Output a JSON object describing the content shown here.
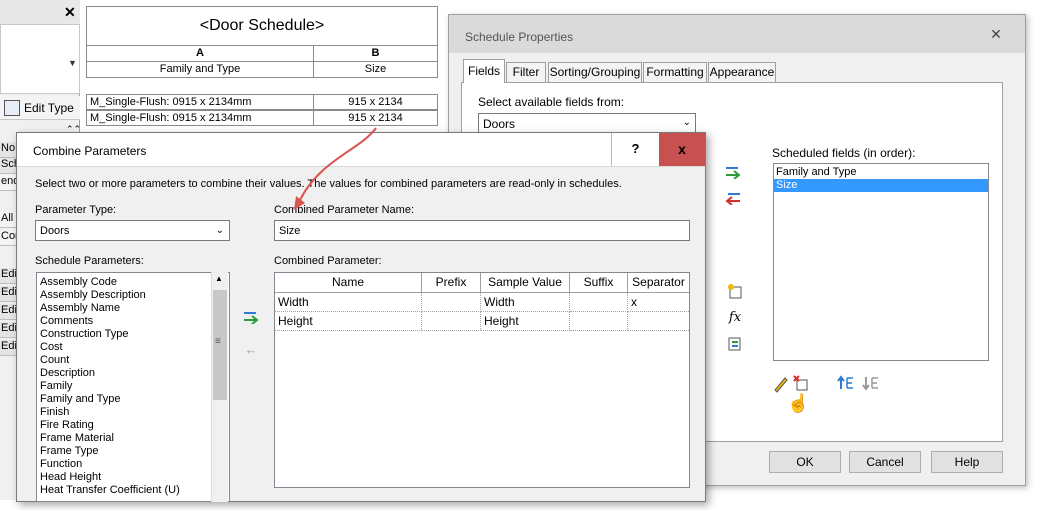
{
  "left_panel": {
    "edit_type_label": "Edit Type",
    "cells": [
      "No",
      "Sch",
      "end",
      "All",
      "Con",
      "Edi",
      "Edi",
      "Edi",
      "Edi",
      "Edi"
    ]
  },
  "schedule": {
    "title": "<Door Schedule>",
    "col_letters": [
      "A",
      "B"
    ],
    "col_names": [
      "Family and Type",
      "Size"
    ],
    "rows": [
      {
        "family_type": "M_Single-Flush: 0915 x 2134mm",
        "size": "915 x 2134"
      },
      {
        "family_type": "M_Single-Flush: 0915 x 2134mm",
        "size": "915 x 2134"
      }
    ]
  },
  "schedule_properties": {
    "title": "Schedule Properties",
    "tabs": [
      "Fields",
      "Filter",
      "Sorting/Grouping",
      "Formatting",
      "Appearance"
    ],
    "active_tab": "Fields",
    "available_label": "Select available fields from:",
    "available_value": "Doors",
    "scheduled_label": "Scheduled fields (in order):",
    "scheduled_fields": [
      "Family and Type",
      "Size"
    ],
    "selected_field": "Size",
    "buttons": {
      "ok": "OK",
      "cancel": "Cancel",
      "help": "Help"
    },
    "fx_label": "fx",
    "selection_color": "#3399ff"
  },
  "combine_parameters": {
    "title": "Combine Parameters",
    "help_label": "?",
    "close_label": "x",
    "instruction": "Select two or more parameters to combine their values.  The values for combined parameters are read-only in schedules.",
    "parameter_type_label": "Parameter Type:",
    "parameter_type_value": "Doors",
    "combined_name_label": "Combined Parameter Name:",
    "combined_name_value": "Size",
    "schedule_params_label": "Schedule Parameters:",
    "schedule_params": [
      "Assembly Code",
      "Assembly Description",
      "Assembly Name",
      "Comments",
      "Construction Type",
      "Cost",
      "Count",
      "Description",
      "Family",
      "Family and Type",
      "Finish",
      "Fire Rating",
      "Frame Material",
      "Frame Type",
      "Function",
      "Head Height",
      "Heat Transfer Coefficient (U)"
    ],
    "combined_param_label": "Combined Parameter:",
    "grid_headers": [
      "Name",
      "Prefix",
      "Sample Value",
      "Suffix",
      "Separator"
    ],
    "grid_rows": [
      {
        "name": "Width",
        "prefix": "",
        "sample": "Width",
        "suffix": "",
        "separator": "x"
      },
      {
        "name": "Height",
        "prefix": "",
        "sample": "Height",
        "suffix": "",
        "separator": ""
      }
    ],
    "close_color": "#c75050"
  },
  "annotation": {
    "arrow_color": "#d9534f"
  }
}
